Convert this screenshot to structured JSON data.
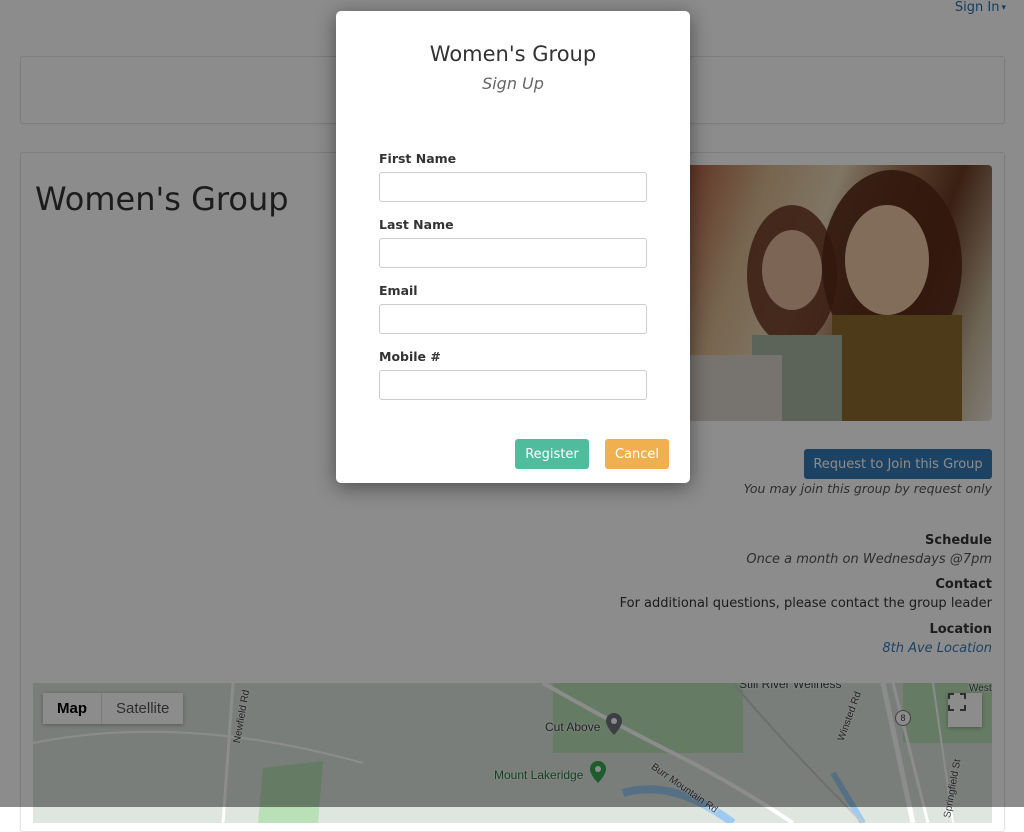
{
  "header": {
    "signin_label": "Sign In"
  },
  "group": {
    "title": "Women's Group",
    "join_button_label": "Request to Join this Group",
    "join_note": "You may join this group by request only",
    "schedule_heading": "Schedule",
    "schedule_value": "Once a month on Wednesdays @7pm",
    "contact_heading": "Contact",
    "contact_value": "For additional questions, please contact the group leader",
    "location_heading": "Location",
    "location_link": "8th Ave Location"
  },
  "map": {
    "tabs": [
      "Map",
      "Satellite"
    ],
    "labels": {
      "cut_above": "Cut Above",
      "mount_lakeridge": "Mount Lakeridge",
      "still_river": "Still River Wellness",
      "newfield_rd": "Newfield Rd",
      "burr_mountain_rd": "Burr Mountain Rd",
      "winsted_rd": "Winsted Rd",
      "springfield_st": "Springfield St",
      "west": "West",
      "route_8": "8"
    }
  },
  "modal": {
    "title": "Women's Group",
    "subtitle": "Sign Up",
    "fields": [
      {
        "label": "First Name",
        "value": "",
        "placeholder": ""
      },
      {
        "label": "Last Name",
        "value": "",
        "placeholder": ""
      },
      {
        "label": "Email",
        "value": "",
        "placeholder": ""
      },
      {
        "label": "Mobile #",
        "value": "",
        "placeholder": ""
      }
    ],
    "register_label": "Register",
    "cancel_label": "Cancel"
  },
  "colors": {
    "link": "#337ab7",
    "join_button": "#337ab7",
    "register_button": "#4fbc9e",
    "cancel_button": "#f0b050",
    "overlay": "rgba(0,0,0,0.45)"
  },
  "icons": [
    "caret-down-icon",
    "fullscreen-icon",
    "map-pin-icon",
    "park-pin-icon"
  ]
}
